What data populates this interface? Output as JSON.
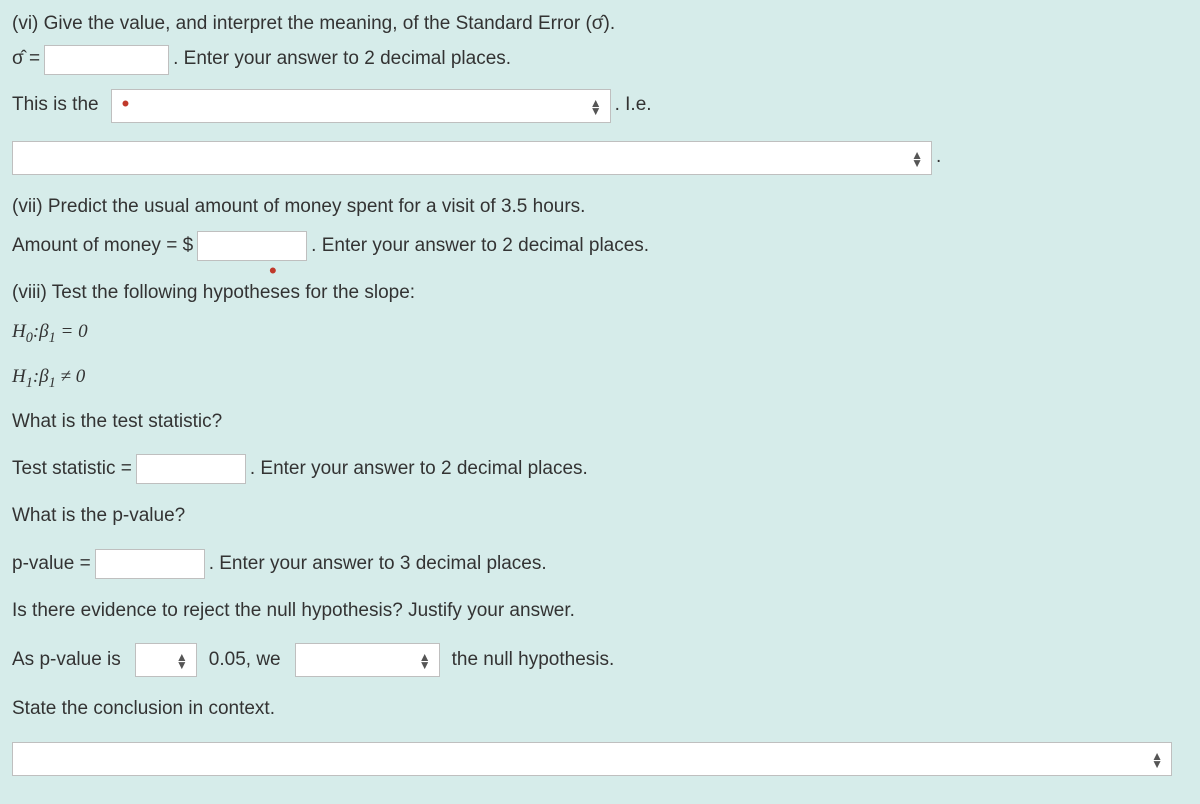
{
  "q6": {
    "prompt": "(vi) Give the value, and interpret the meaning, of the Standard Error (σ̂).",
    "sigma_label": "σ̂ =",
    "after_sigma": ". Enter your answer to 2 decimal places.",
    "this_is_the": "This is the",
    "dot": "•",
    "ie": ". I.e.",
    "trailing_period": "."
  },
  "q7": {
    "prompt": "(vii) Predict the usual amount of money spent for a visit of 3.5 hours.",
    "amount_label": "Amount of money = $",
    "after_amount": ". Enter your answer to 2 decimal places."
  },
  "q8": {
    "dot": "•",
    "prompt": "(viii) Test the following hypotheses for the slope:",
    "h0_pre": "H",
    "h0_sub": "0",
    "h0_mid": ":β",
    "h0_sub2": "1",
    "h0_post": " = 0",
    "h1_pre": "H",
    "h1_sub": "1",
    "h1_mid": ":β",
    "h1_sub2": "1",
    "h1_post": " ≠ 0",
    "what_ts": "What is the test statistic?",
    "ts_label": "Test statistic =",
    "ts_after": ". Enter your answer to 2 decimal places.",
    "what_p": "What is the p-value?",
    "p_label": "p-value =",
    "p_after": ". Enter your answer to 3 decimal places.",
    "evidence": "Is there evidence to reject the null hypothesis? Justify your answer.",
    "as_p": "As p-value is",
    "threshold": "0.05, we",
    "null_hyp": "the null hypothesis.",
    "conclusion": "State the conclusion in context."
  }
}
